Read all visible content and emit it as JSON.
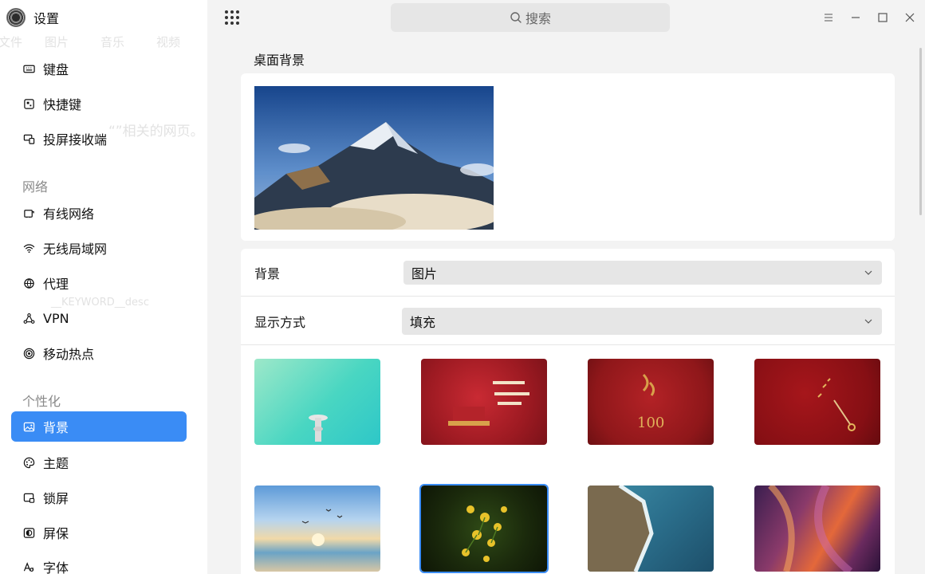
{
  "app": {
    "title": "设置"
  },
  "ghost": {
    "tabs": [
      "文件",
      "图片",
      "音乐",
      "视频"
    ],
    "snippet": "“”相关的网页。",
    "placeholder": "__KEYWORD__desc"
  },
  "sidebar": {
    "items_device": [
      {
        "label": "键盘",
        "icon": "keyboard-icon"
      },
      {
        "label": "快捷键",
        "icon": "shortcut-icon"
      },
      {
        "label": "投屏接收端",
        "icon": "cast-icon"
      }
    ],
    "section_network": "网络",
    "items_network": [
      {
        "label": "有线网络",
        "icon": "ethernet-icon"
      },
      {
        "label": "无线局域网",
        "icon": "wifi-icon"
      },
      {
        "label": "代理",
        "icon": "proxy-icon"
      },
      {
        "label": "VPN",
        "icon": "vpn-icon"
      },
      {
        "label": "移动热点",
        "icon": "hotspot-icon"
      }
    ],
    "section_personalize": "个性化",
    "items_personalize": [
      {
        "label": "背景",
        "icon": "image-icon",
        "active": true
      },
      {
        "label": "主题",
        "icon": "palette-icon"
      },
      {
        "label": "锁屏",
        "icon": "lock-screen-icon"
      },
      {
        "label": "屏保",
        "icon": "screensaver-icon"
      },
      {
        "label": "字体",
        "icon": "font-icon"
      }
    ]
  },
  "toolbar": {
    "search_placeholder": "搜索"
  },
  "main": {
    "section_title": "桌面背景",
    "background_label": "背景",
    "background_value": "图片",
    "display_label": "显示方式",
    "display_value": "填充",
    "wallpapers": [
      {
        "name": "mint-gradient-lighthouse",
        "selected": false
      },
      {
        "name": "red-centenary-tiananmen",
        "selected": false
      },
      {
        "name": "red-100-calligraphy",
        "selected": false
      },
      {
        "name": "red-clock-hand",
        "selected": false
      },
      {
        "name": "seaside-sunrise-birds",
        "selected": false
      },
      {
        "name": "yellow-flowers",
        "selected": true
      },
      {
        "name": "aerial-coastline",
        "selected": false
      },
      {
        "name": "antelope-canyon",
        "selected": false
      }
    ]
  },
  "colors": {
    "accent": "#3a8cf5",
    "sidebar_bg": "#ffffff",
    "main_bg": "#f3f3f3"
  }
}
